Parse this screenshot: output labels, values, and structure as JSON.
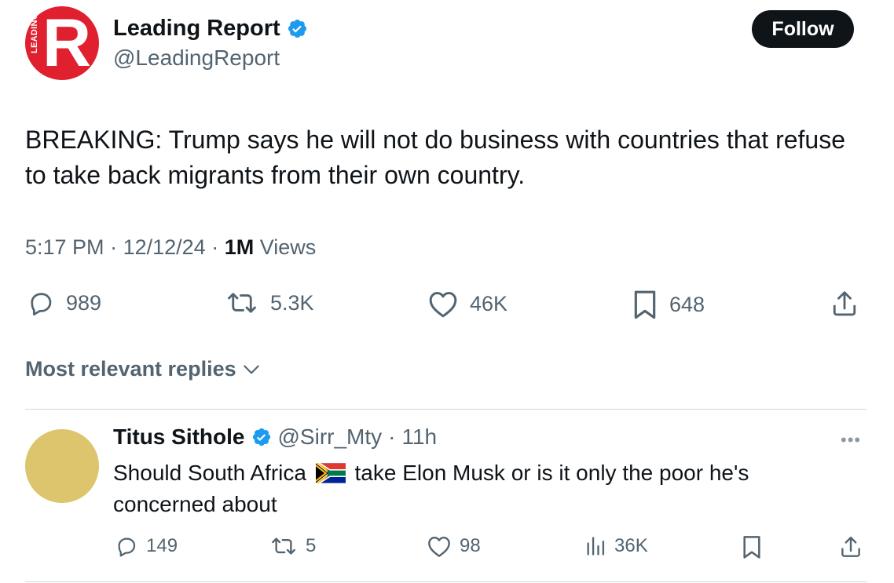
{
  "tweet": {
    "author_name": "Leading Report",
    "author_handle": "@LeadingReport",
    "logo_letter": "R",
    "logo_text": "LEADING",
    "follow_label": "Follow",
    "text": "BREAKING: Trump says he will not do business with countries that refuse to take back migrants from their own country.",
    "time": "5:17 PM",
    "date": "12/12/24",
    "views_count": "1M",
    "views_label": "Views",
    "replies": "989",
    "reposts": "5.3K",
    "likes": "46K",
    "bookmarks": "648"
  },
  "replies_filter": {
    "label": "Most relevant replies"
  },
  "reply": {
    "name": "Titus Sithole",
    "handle": "@Sirr_Mty",
    "age": "11h",
    "text_before": "Should South Africa",
    "text_after": "take Elon Musk or is it only the poor he's concerned about",
    "replies": "149",
    "reposts": "5",
    "likes": "98",
    "views": "36K"
  },
  "colors": {
    "brand_red": "#e0202e",
    "verified_blue": "#1d9bf0",
    "text_primary": "#0f1419",
    "text_secondary": "#536471"
  },
  "icons": [
    "verified-badge-icon",
    "reply-icon",
    "repost-icon",
    "like-icon",
    "bookmark-icon",
    "share-icon",
    "chevron-down-icon",
    "views-icon",
    "more-icon",
    "south-africa-flag-icon"
  ]
}
